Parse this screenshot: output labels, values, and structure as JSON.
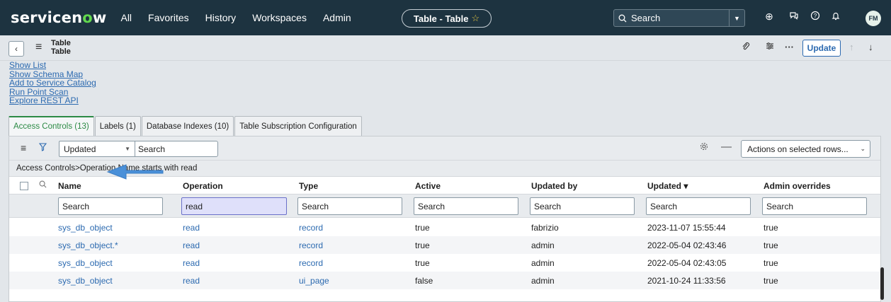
{
  "topbar": {
    "logo_text": "servicen",
    "logo_o": "o",
    "logo_tail": "w",
    "nav": [
      "All",
      "Favorites",
      "History",
      "Workspaces",
      "Admin"
    ],
    "context_pill": "Table - Table",
    "star_icon": "☆",
    "search_placeholder": "Search",
    "avatar_initials": "FM"
  },
  "record_header": {
    "title_line1": "Table",
    "title_line2": "Table",
    "update_label": "Update"
  },
  "related_links": [
    "Show List",
    "Show Schema Map",
    "Add to Service Catalog",
    "Run Point Scan",
    "Explore REST API"
  ],
  "tabs": [
    {
      "label": "Access Controls (13)",
      "active": true
    },
    {
      "label": "Labels (1)",
      "active": false
    },
    {
      "label": "Database Indexes (10)",
      "active": false
    },
    {
      "label": "Table Subscription Configuration",
      "active": false
    }
  ],
  "list_toolbar": {
    "field_select": "Updated",
    "search_placeholder": "Search",
    "actions_label": "Actions on selected rows..."
  },
  "breadcrumb": "Access Controls>Operation Name starts with read",
  "columns": [
    "Name",
    "Operation",
    "Type",
    "Active",
    "Updated by",
    "Updated ▾",
    "Admin overrides"
  ],
  "column_search": [
    "Search",
    "read",
    "Search",
    "Search",
    "Search",
    "Search",
    "Search"
  ],
  "rows": [
    [
      "sys_db_object",
      "read",
      "record",
      "true",
      "fabrizio",
      "2023-11-07 15:55:44",
      "true"
    ],
    [
      "sys_db_object.*",
      "read",
      "record",
      "true",
      "admin",
      "2022-05-04 02:43:46",
      "true"
    ],
    [
      "sys_db_object",
      "read",
      "record",
      "true",
      "admin",
      "2022-05-04 02:43:05",
      "true"
    ],
    [
      "sys_db_object",
      "read",
      "ui_page",
      "false",
      "admin",
      "2021-10-24 11:33:56",
      "true"
    ]
  ],
  "colors": {
    "topbar": "#1d3340",
    "accent_green": "#62d84e",
    "link_blue": "#2c6ab0",
    "arrow_blue": "#4a90d9"
  }
}
